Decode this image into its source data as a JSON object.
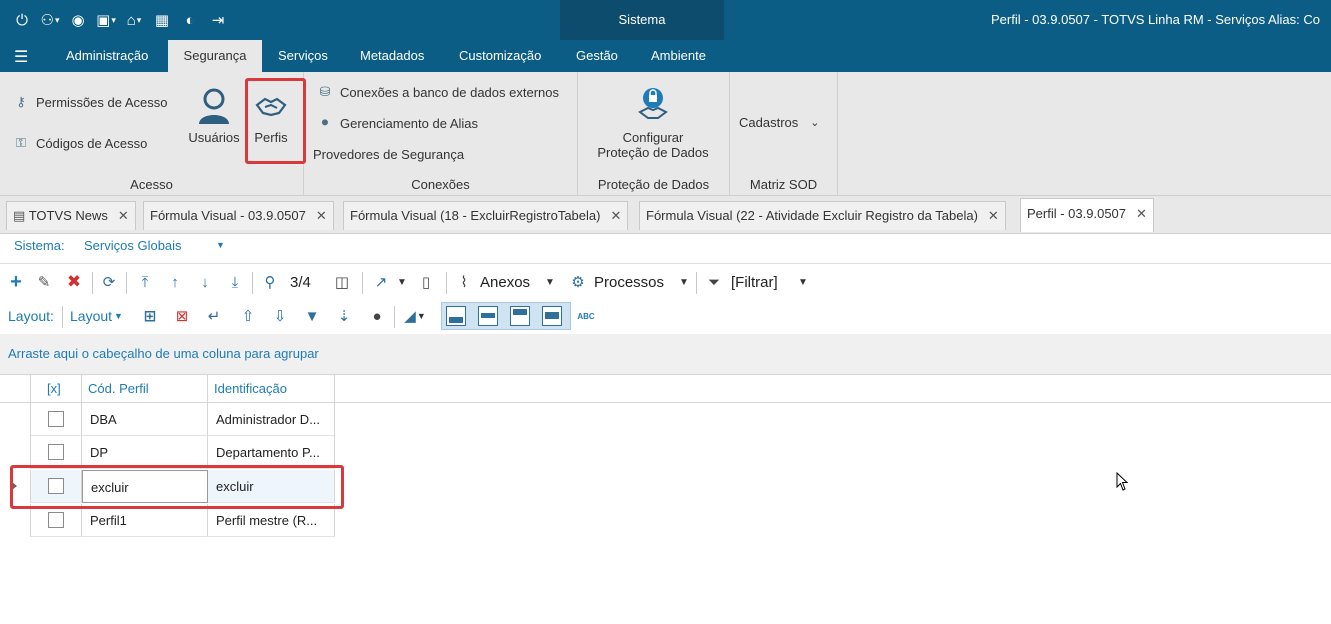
{
  "title_bar": {
    "context_tab": "Sistema",
    "window_title": "Perfil - 03.9.0507 - TOTVS Linha RM - Serviços  Alias: Co"
  },
  "menu": {
    "tabs": [
      "Administração",
      "Segurança",
      "Serviços",
      "Metadados",
      "Customização",
      "Gestão",
      "Ambiente"
    ],
    "active": "Segurança"
  },
  "ribbon": {
    "acesso": {
      "label": "Acesso",
      "permissoes": "Permissões de Acesso",
      "codigos": "Códigos de Acesso",
      "usuarios": "Usuários",
      "perfis": "Perfis"
    },
    "conexoes": {
      "label": "Conexões",
      "bancos": "Conexões a banco de dados externos",
      "alias": "Gerenciamento de Alias",
      "provedores": "Provedores de Segurança"
    },
    "protecao": {
      "label": "Proteção de Dados",
      "btn_line1": "Configurar",
      "btn_line2": "Proteção de Dados"
    },
    "matriz": {
      "label": "Matriz SOD",
      "cadastros": "Cadastros"
    }
  },
  "doc_tabs": [
    {
      "label": "TOTVS News",
      "active": false
    },
    {
      "label": "Fórmula Visual - 03.9.0507",
      "active": false
    },
    {
      "label": "Fórmula Visual (18 - ExcluirRegistroTabela)",
      "active": false
    },
    {
      "label": "Fórmula Visual (22 - Atividade Excluir Registro da Tabela)",
      "active": false
    },
    {
      "label": "Perfil - 03.9.0507",
      "active": true
    }
  ],
  "system_selector": {
    "label": "Sistema:",
    "value": "Serviços Globais"
  },
  "toolbar": {
    "record_position": "3/4",
    "anexos": "Anexos",
    "processos": "Processos",
    "filtrar": "[Filtrar]"
  },
  "layout_toolbar": {
    "label": "Layout:",
    "layout_menu": "Layout"
  },
  "group_panel_hint": "Arraste aqui o cabeçalho de uma coluna para agrupar",
  "grid": {
    "columns": [
      "[x]",
      "Cód. Perfil",
      "Identificação"
    ],
    "rows": [
      {
        "code": "DBA",
        "name": "Administrador D..."
      },
      {
        "code": "DP",
        "name": "Departamento P..."
      },
      {
        "code": "excluir",
        "name": "excluir"
      },
      {
        "code": "Perfil1",
        "name": "Perfil mestre (R..."
      }
    ],
    "current_row": 2
  },
  "colors": {
    "brand_bar": "#0b5d85",
    "highlight_box": "#d9393c",
    "link_blue": "#1e7bb8"
  }
}
